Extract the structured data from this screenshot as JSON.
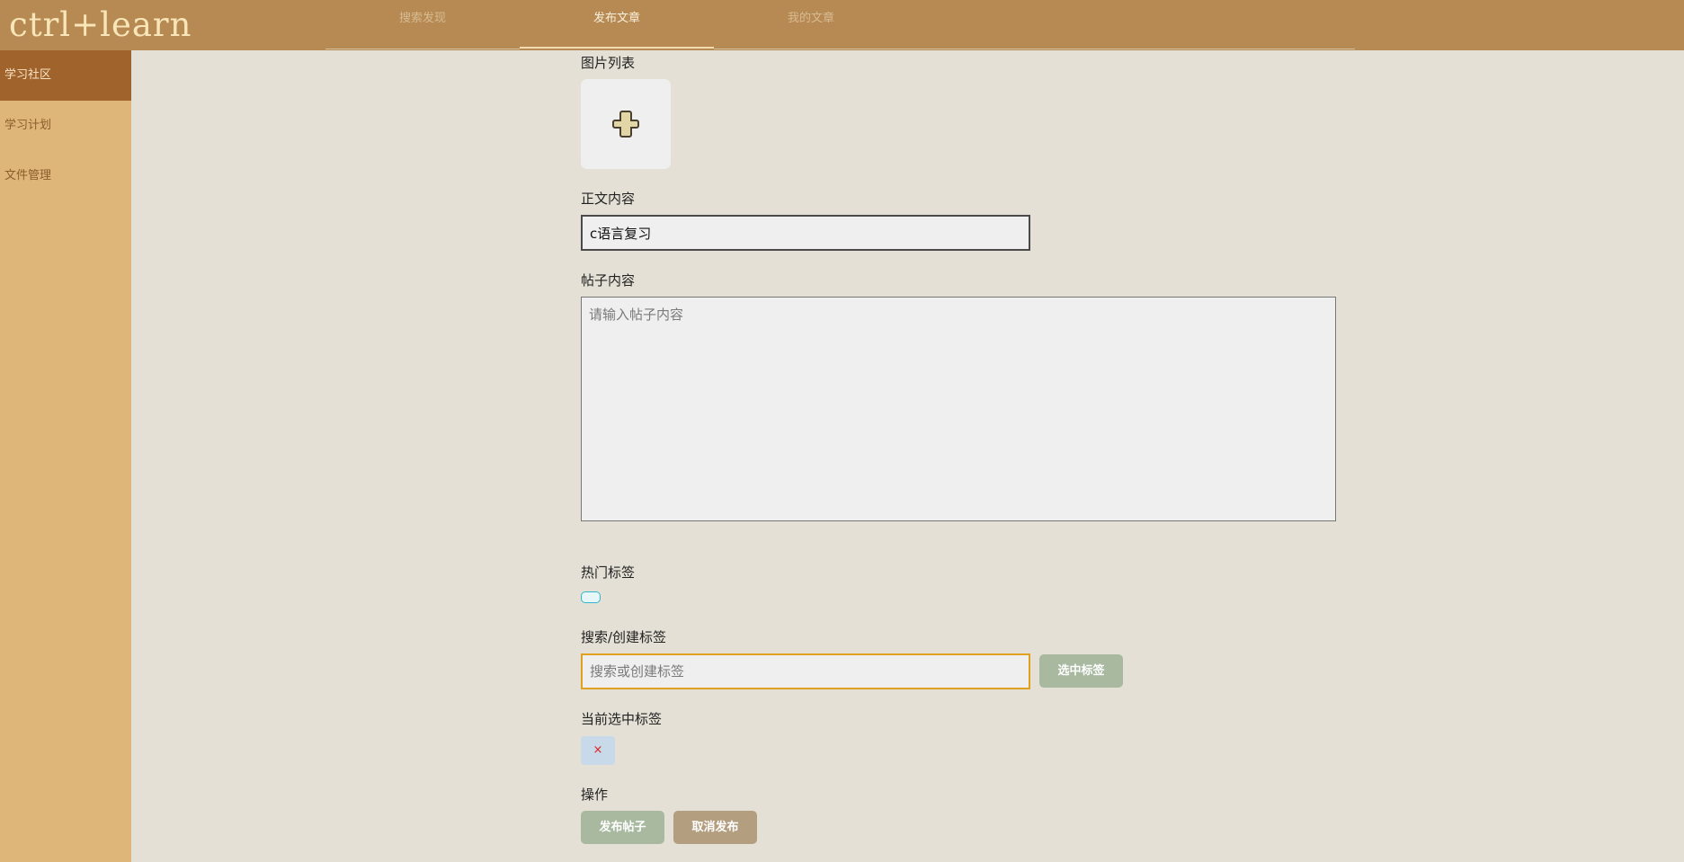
{
  "app": {
    "logo": "ctrl+learn"
  },
  "nav": {
    "tabs": [
      {
        "label": "搜索发现"
      },
      {
        "label": "发布文章"
      },
      {
        "label": "我的文章"
      }
    ]
  },
  "sidebar": {
    "items": [
      {
        "label": "学习社区"
      },
      {
        "label": "学习计划"
      },
      {
        "label": "文件管理"
      }
    ]
  },
  "form": {
    "image_list_label": "图片列表",
    "body_label": "正文内容",
    "body_value": "c语言复习",
    "post_label": "帖子内容",
    "post_placeholder": "请输入帖子内容",
    "hot_tags_label": "热门标签",
    "search_tag_label": "搜索/创建标签",
    "search_tag_placeholder": "搜索或创建标签",
    "select_tag_button": "选中标签",
    "current_tags_label": "当前选中标签",
    "remove_tag_glyph": "×",
    "actions_label": "操作",
    "publish_button": "发布帖子",
    "cancel_button": "取消发布"
  },
  "colors": {
    "header": "#b88a53",
    "sidebar": "#dfb679",
    "sidebar_active": "#a1632c",
    "background": "#e4e0d5",
    "button_green": "#a8b9a0",
    "button_tan": "#b49e80",
    "hot_tag_border": "#31b6c9",
    "selected_tag_bg": "#c8d9ea"
  },
  "icons": {
    "upload": "plus-icon",
    "remove": "close-icon"
  }
}
